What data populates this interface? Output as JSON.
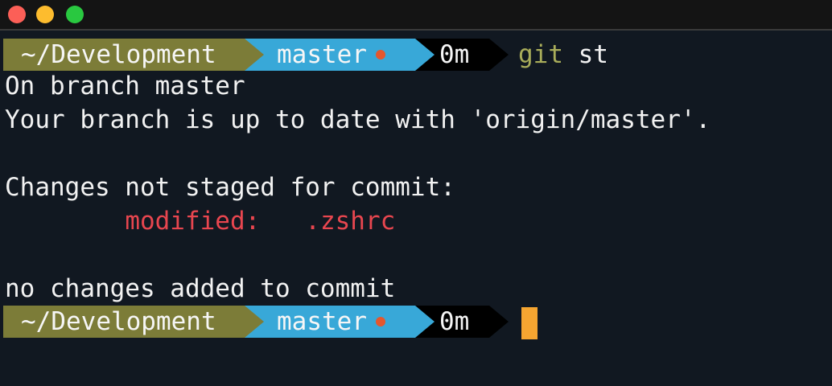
{
  "window": {
    "buttons": [
      "close",
      "minimize",
      "zoom"
    ],
    "colors": {
      "background": "#111821",
      "close": "#fc5f57",
      "minimize": "#fdbc2e",
      "zoom": "#29c840"
    }
  },
  "prompt": {
    "directory": "~/Development",
    "branch": "master",
    "branch_dirty_indicator": "orange-dot-icon",
    "duration": "0m",
    "colors": {
      "directory_bg": "#7c7c38",
      "branch_bg": "#38a8d8",
      "duration_bg": "#000000",
      "dirty_dot": "#e4572e",
      "cursor": "#f5a531"
    }
  },
  "command": {
    "program": "git",
    "args": " st"
  },
  "output": {
    "line1": "On branch master",
    "line2": "Your branch is up to date with 'origin/master'.",
    "line3": "Changes not staged for commit:",
    "modified_label": "modified:",
    "modified_file": ".zshrc",
    "line4": "no changes added to commit",
    "modified_color": "#e8464f"
  }
}
